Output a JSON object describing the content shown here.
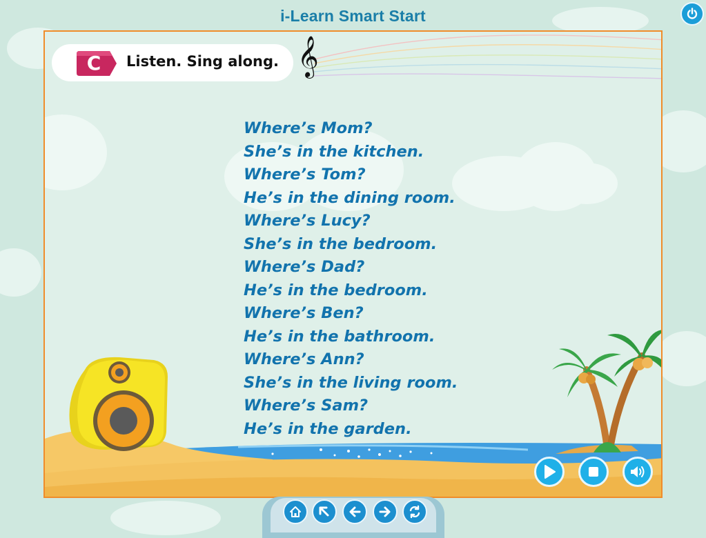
{
  "app": {
    "title": "i-Learn Smart Start"
  },
  "header": {
    "section_letter": "C",
    "instruction": "Listen. Sing along."
  },
  "lyrics": [
    "Where’s Mom?",
    "She’s in the kitchen.",
    "Where’s Tom?",
    "He’s in the dining room.",
    "Where’s Lucy?",
    "She’s in the bedroom.",
    "Where’s Dad?",
    "He’s in the bedroom.",
    "Where’s Ben?",
    "He’s in the bathroom.",
    "Where’s Ann?",
    "She’s in the living room.",
    "Where’s Sam?",
    "He’s in the garden."
  ],
  "icons": {
    "power": "power-icon",
    "play": "play-icon",
    "stop": "stop-icon",
    "volume": "volume-icon",
    "home": "home-icon",
    "back_up": "arrow-up-left-icon",
    "previous": "arrow-left-icon",
    "next": "arrow-right-icon",
    "replay": "replay-icon",
    "clef": "treble-clef-icon"
  },
  "colors": {
    "accent": "#1fb0e8",
    "frame": "#f08c2a",
    "lyrics": "#1273ad",
    "badge": "#c8275f",
    "title": "#1a7ea8"
  }
}
